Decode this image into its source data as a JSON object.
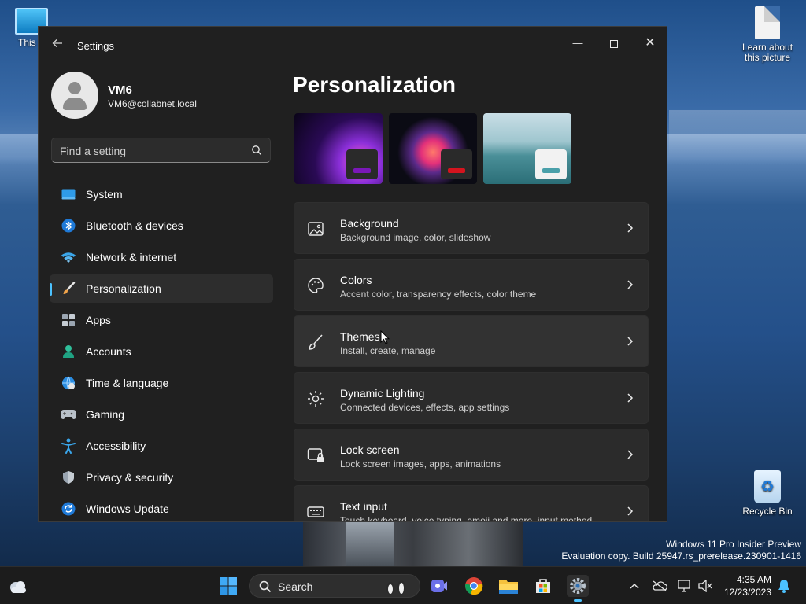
{
  "desktop": {
    "icons": [
      {
        "name": "this-pc",
        "label": "This P"
      },
      {
        "name": "learn-about-picture",
        "label": "Learn about this picture"
      },
      {
        "name": "recycle-bin",
        "label": "Recycle Bin"
      }
    ],
    "watermark": {
      "line1": "Windows 11 Pro Insider Preview",
      "line2": "Evaluation copy. Build 25947.rs_prerelease.230901-1416"
    }
  },
  "window": {
    "title": "Settings",
    "controls": {
      "minimize": "—",
      "close": "✕"
    }
  },
  "profile": {
    "name": "VM6",
    "email": "VM6@collabnet.local"
  },
  "search": {
    "placeholder": "Find a setting"
  },
  "sidebar": {
    "items": [
      {
        "label": "System",
        "icon": "system-icon",
        "active": false
      },
      {
        "label": "Bluetooth & devices",
        "icon": "bluetooth-icon",
        "active": false
      },
      {
        "label": "Network & internet",
        "icon": "wifi-icon",
        "active": false
      },
      {
        "label": "Personalization",
        "icon": "brush-icon",
        "active": true
      },
      {
        "label": "Apps",
        "icon": "apps-icon",
        "active": false
      },
      {
        "label": "Accounts",
        "icon": "accounts-icon",
        "active": false
      },
      {
        "label": "Time & language",
        "icon": "globe-clock-icon",
        "active": false
      },
      {
        "label": "Gaming",
        "icon": "gamepad-icon",
        "active": false
      },
      {
        "label": "Accessibility",
        "icon": "accessibility-icon",
        "active": false
      },
      {
        "label": "Privacy & security",
        "icon": "shield-icon",
        "active": false
      },
      {
        "label": "Windows Update",
        "icon": "update-icon",
        "active": false
      }
    ]
  },
  "main": {
    "title": "Personalization",
    "themes": [
      {
        "name": "theme-glow",
        "accent": "#7a18b8"
      },
      {
        "name": "theme-bloom",
        "accent": "#d4141e"
      },
      {
        "name": "theme-lake",
        "accent": "#4aa0aa"
      }
    ],
    "cards": [
      {
        "title": "Background",
        "subtitle": "Background image, color, slideshow",
        "icon": "image-icon"
      },
      {
        "title": "Colors",
        "subtitle": "Accent color, transparency effects, color theme",
        "icon": "palette-icon"
      },
      {
        "title": "Themes",
        "subtitle": "Install, create, manage",
        "icon": "brush-icon"
      },
      {
        "title": "Dynamic Lighting",
        "subtitle": "Connected devices, effects, app settings",
        "icon": "lighting-icon"
      },
      {
        "title": "Lock screen",
        "subtitle": "Lock screen images, apps, animations",
        "icon": "lock-screen-icon"
      },
      {
        "title": "Text input",
        "subtitle": "Touch keyboard, voice typing, emoji and more, input method",
        "icon": "keyboard-icon"
      }
    ]
  },
  "taskbar": {
    "search_label": "Search",
    "apps": [
      "teams-icon",
      "chrome-icon",
      "file-explorer-icon",
      "store-icon",
      "settings-icon"
    ],
    "clock": {
      "time": "4:35 AM",
      "date": "12/23/2023"
    }
  },
  "colors": {
    "accent": "#4cc2ff",
    "window_bg": "#202020",
    "card_bg": "#2b2b2b"
  }
}
